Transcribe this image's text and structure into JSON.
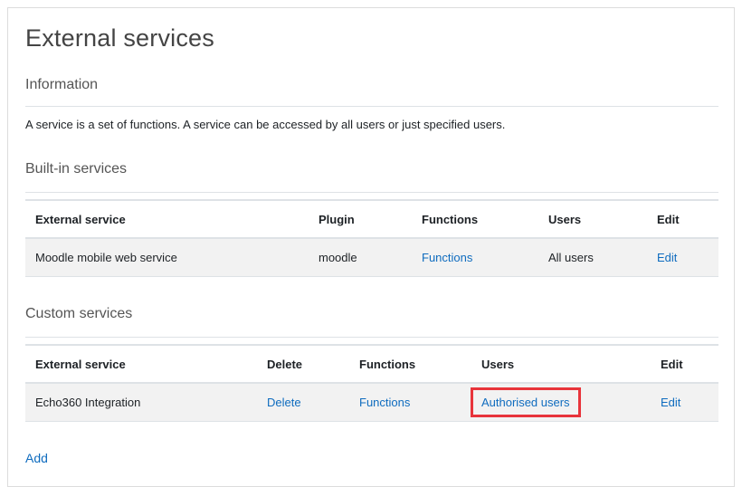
{
  "page": {
    "title": "External services"
  },
  "information": {
    "heading": "Information",
    "text": "A service is a set of functions. A service can be accessed by all users or just specified users."
  },
  "builtin": {
    "heading": "Built-in services",
    "columns": [
      "External service",
      "Plugin",
      "Functions",
      "Users",
      "Edit"
    ],
    "rows": [
      {
        "service": "Moodle mobile web service",
        "plugin": "moodle",
        "functions": "Functions",
        "users": "All users",
        "edit": "Edit"
      }
    ]
  },
  "custom": {
    "heading": "Custom services",
    "columns": [
      "External service",
      "Delete",
      "Functions",
      "Users",
      "Edit"
    ],
    "rows": [
      {
        "service": "Echo360 Integration",
        "delete": "Delete",
        "functions": "Functions",
        "users": "Authorised users",
        "edit": "Edit"
      }
    ]
  },
  "actions": {
    "add": "Add"
  },
  "colors": {
    "link": "#0f6cbf",
    "highlight": "#e8343b",
    "row_bg": "#f2f2f2"
  }
}
